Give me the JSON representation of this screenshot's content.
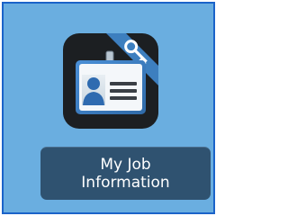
{
  "app": {
    "label_line1": "My Job",
    "label_line2": "Information",
    "icon": "id-badge-with-key-icon"
  },
  "colors": {
    "background": "#6aaee0",
    "border": "#1b63c9",
    "icon_tile": "#1c1f22",
    "icon_ribbon": "#3d7fbf",
    "badge_frame": "#3f7dc0",
    "label_button": "#2f5270"
  }
}
